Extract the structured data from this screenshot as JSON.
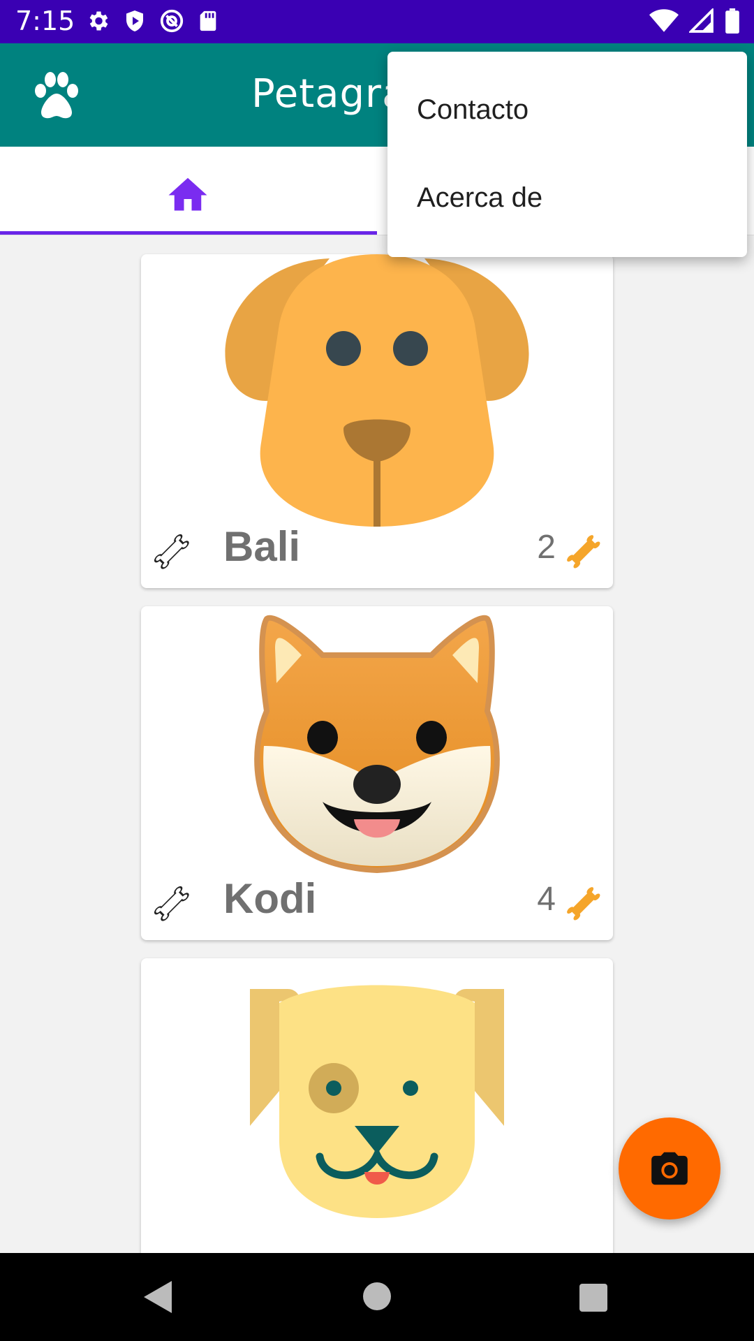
{
  "status_bar": {
    "time": "7:15",
    "left_icons": [
      "gear-icon",
      "play-protect-icon",
      "at-sign-icon",
      "sd-card-icon"
    ],
    "right_icons": [
      "wifi-icon",
      "signal-icon",
      "battery-icon"
    ]
  },
  "app_bar": {
    "title": "Petagram",
    "icon": "paw-icon"
  },
  "tabs": [
    {
      "icon": "home-icon",
      "selected": true
    },
    {
      "icon": "",
      "selected": false
    }
  ],
  "pets": [
    {
      "name": "Bali",
      "likes": "2"
    },
    {
      "name": "Kodi",
      "likes": "4"
    },
    {
      "name": "",
      "likes": ""
    }
  ],
  "fab": {
    "icon": "camera-icon"
  },
  "overflow_menu": {
    "items": [
      {
        "label": "Contacto"
      },
      {
        "label": "Acerca de"
      }
    ]
  },
  "nav_bar": {
    "icons": [
      "back-icon",
      "home-circle-icon",
      "recents-icon"
    ]
  },
  "colors": {
    "status_bar": "#3a00b3",
    "app_bar": "#00827f",
    "tab_indicator": "#6a26e8",
    "fab": "#ff6a00",
    "bone_accent": "#f5a52a"
  }
}
